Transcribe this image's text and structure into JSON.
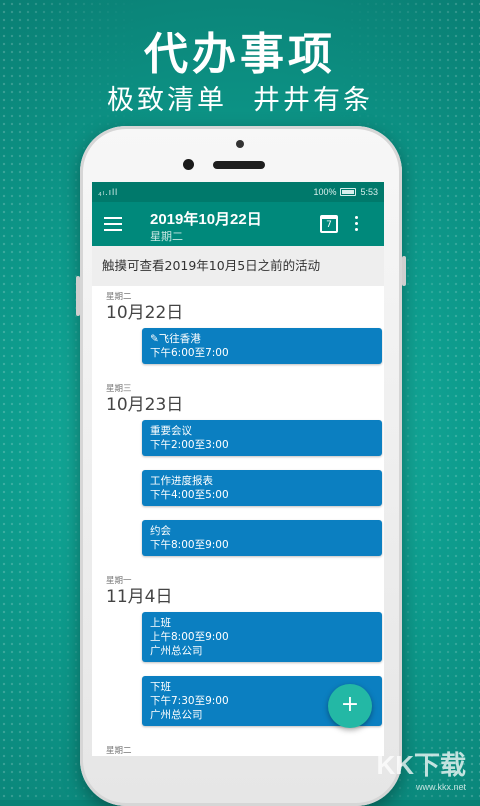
{
  "promo": {
    "headline": "代办事项",
    "tagline_left": "极致清单",
    "tagline_right": "井井有条"
  },
  "status_bar": {
    "signal": "₄ₗ.ıll",
    "battery_percent": "100%",
    "time": "5:53"
  },
  "app_bar": {
    "title": "2019年10月22日",
    "subtitle": "星期二",
    "calendar_day": "7"
  },
  "banner": "触摸可查看2019年10月5日之前的活动",
  "days": [
    {
      "weekday": "星期二",
      "date": "10月22日",
      "events": [
        {
          "title": "✎飞往香港",
          "time": "下午6:00至7:00",
          "location": ""
        }
      ]
    },
    {
      "weekday": "星期三",
      "date": "10月23日",
      "events": [
        {
          "title": "重要会议",
          "time": "下午2:00至3:00",
          "location": ""
        },
        {
          "title": "工作进度报表",
          "time": "下午4:00至5:00",
          "location": ""
        },
        {
          "title": "约会",
          "time": "下午8:00至9:00",
          "location": ""
        }
      ]
    },
    {
      "weekday": "星期一",
      "date": "11月4日",
      "events": [
        {
          "title": "上班",
          "time": "上午8:00至9:00",
          "location": "广州总公司"
        },
        {
          "title": "下班",
          "time": "下午7:30至9:00",
          "location": "广州总公司"
        }
      ]
    },
    {
      "weekday": "星期二",
      "date": "",
      "events": []
    }
  ],
  "fab_label": "+",
  "watermark": {
    "text": "KK下载",
    "sub": "www.kkx.net"
  },
  "colors": {
    "primary": "#00897b",
    "event": "#0b7fc1",
    "fab": "#23b8a5"
  }
}
